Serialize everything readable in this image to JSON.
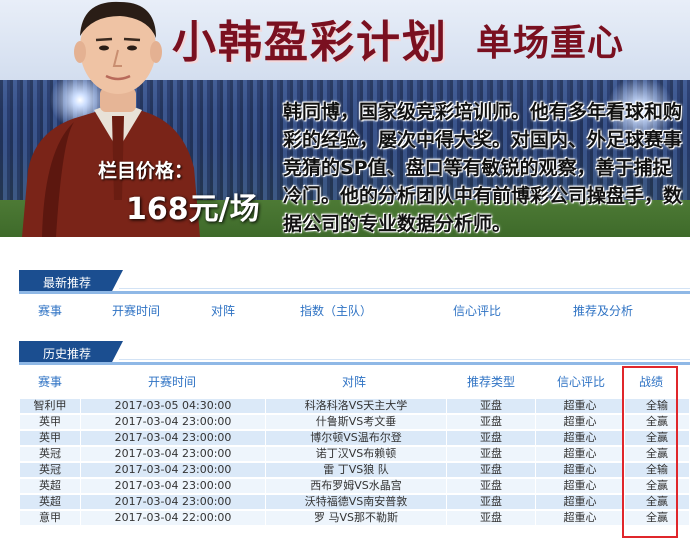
{
  "banner": {
    "title_main": "小韩盈彩计划",
    "title_sub": "单场重心",
    "price_label": "栏目价格：",
    "price_value": "168元/场",
    "intro": "韩同博，国家级竞彩培训师。他有多年看球和购彩的经验，屡次中得大奖。对国内、外足球赛事竞猜的SP值、盘口等有敏锐的观察，善于捕捉冷门。他的分析团队中有前博彩公司操盘手，数据公司的专业数据分析师。"
  },
  "latest": {
    "title": "最新推荐",
    "columns": [
      "赛事",
      "开赛时间",
      "对阵",
      "指数（主队）",
      "信心评比",
      "推荐及分析"
    ]
  },
  "history": {
    "title": "历史推荐",
    "columns": [
      "赛事",
      "开赛时间",
      "对阵",
      "推荐类型",
      "信心评比",
      "战绩"
    ],
    "rows": [
      [
        "智利甲",
        "2017-03-05 04:30:00",
        "科洛科洛VS天主大学",
        "亚盘",
        "超重心",
        "全输"
      ],
      [
        "英甲",
        "2017-03-04 23:00:00",
        "什鲁斯VS考文垂",
        "亚盘",
        "超重心",
        "全赢"
      ],
      [
        "英甲",
        "2017-03-04 23:00:00",
        "博尔顿VS温布尔登",
        "亚盘",
        "超重心",
        "全赢"
      ],
      [
        "英冠",
        "2017-03-04 23:00:00",
        "诺丁汉VS布赖顿",
        "亚盘",
        "超重心",
        "全赢"
      ],
      [
        "英冠",
        "2017-03-04 23:00:00",
        "雷 丁VS狼 队",
        "亚盘",
        "超重心",
        "全输"
      ],
      [
        "英超",
        "2017-03-04 23:00:00",
        "西布罗姆VS水晶宫",
        "亚盘",
        "超重心",
        "全赢"
      ],
      [
        "英超",
        "2017-03-04 23:00:00",
        "沃特福德VS南安普敦",
        "亚盘",
        "超重心",
        "全赢"
      ],
      [
        "意甲",
        "2017-03-04 22:00:00",
        "罗 马VS那不勒斯",
        "亚盘",
        "超重心",
        "全赢"
      ]
    ]
  },
  "colors": {
    "accent": "#1b4e90",
    "header_text": "#2f73c4",
    "highlight_border": "#e0262b",
    "title": "#7a1020"
  },
  "icons": {
    "portrait": "man-portrait"
  }
}
